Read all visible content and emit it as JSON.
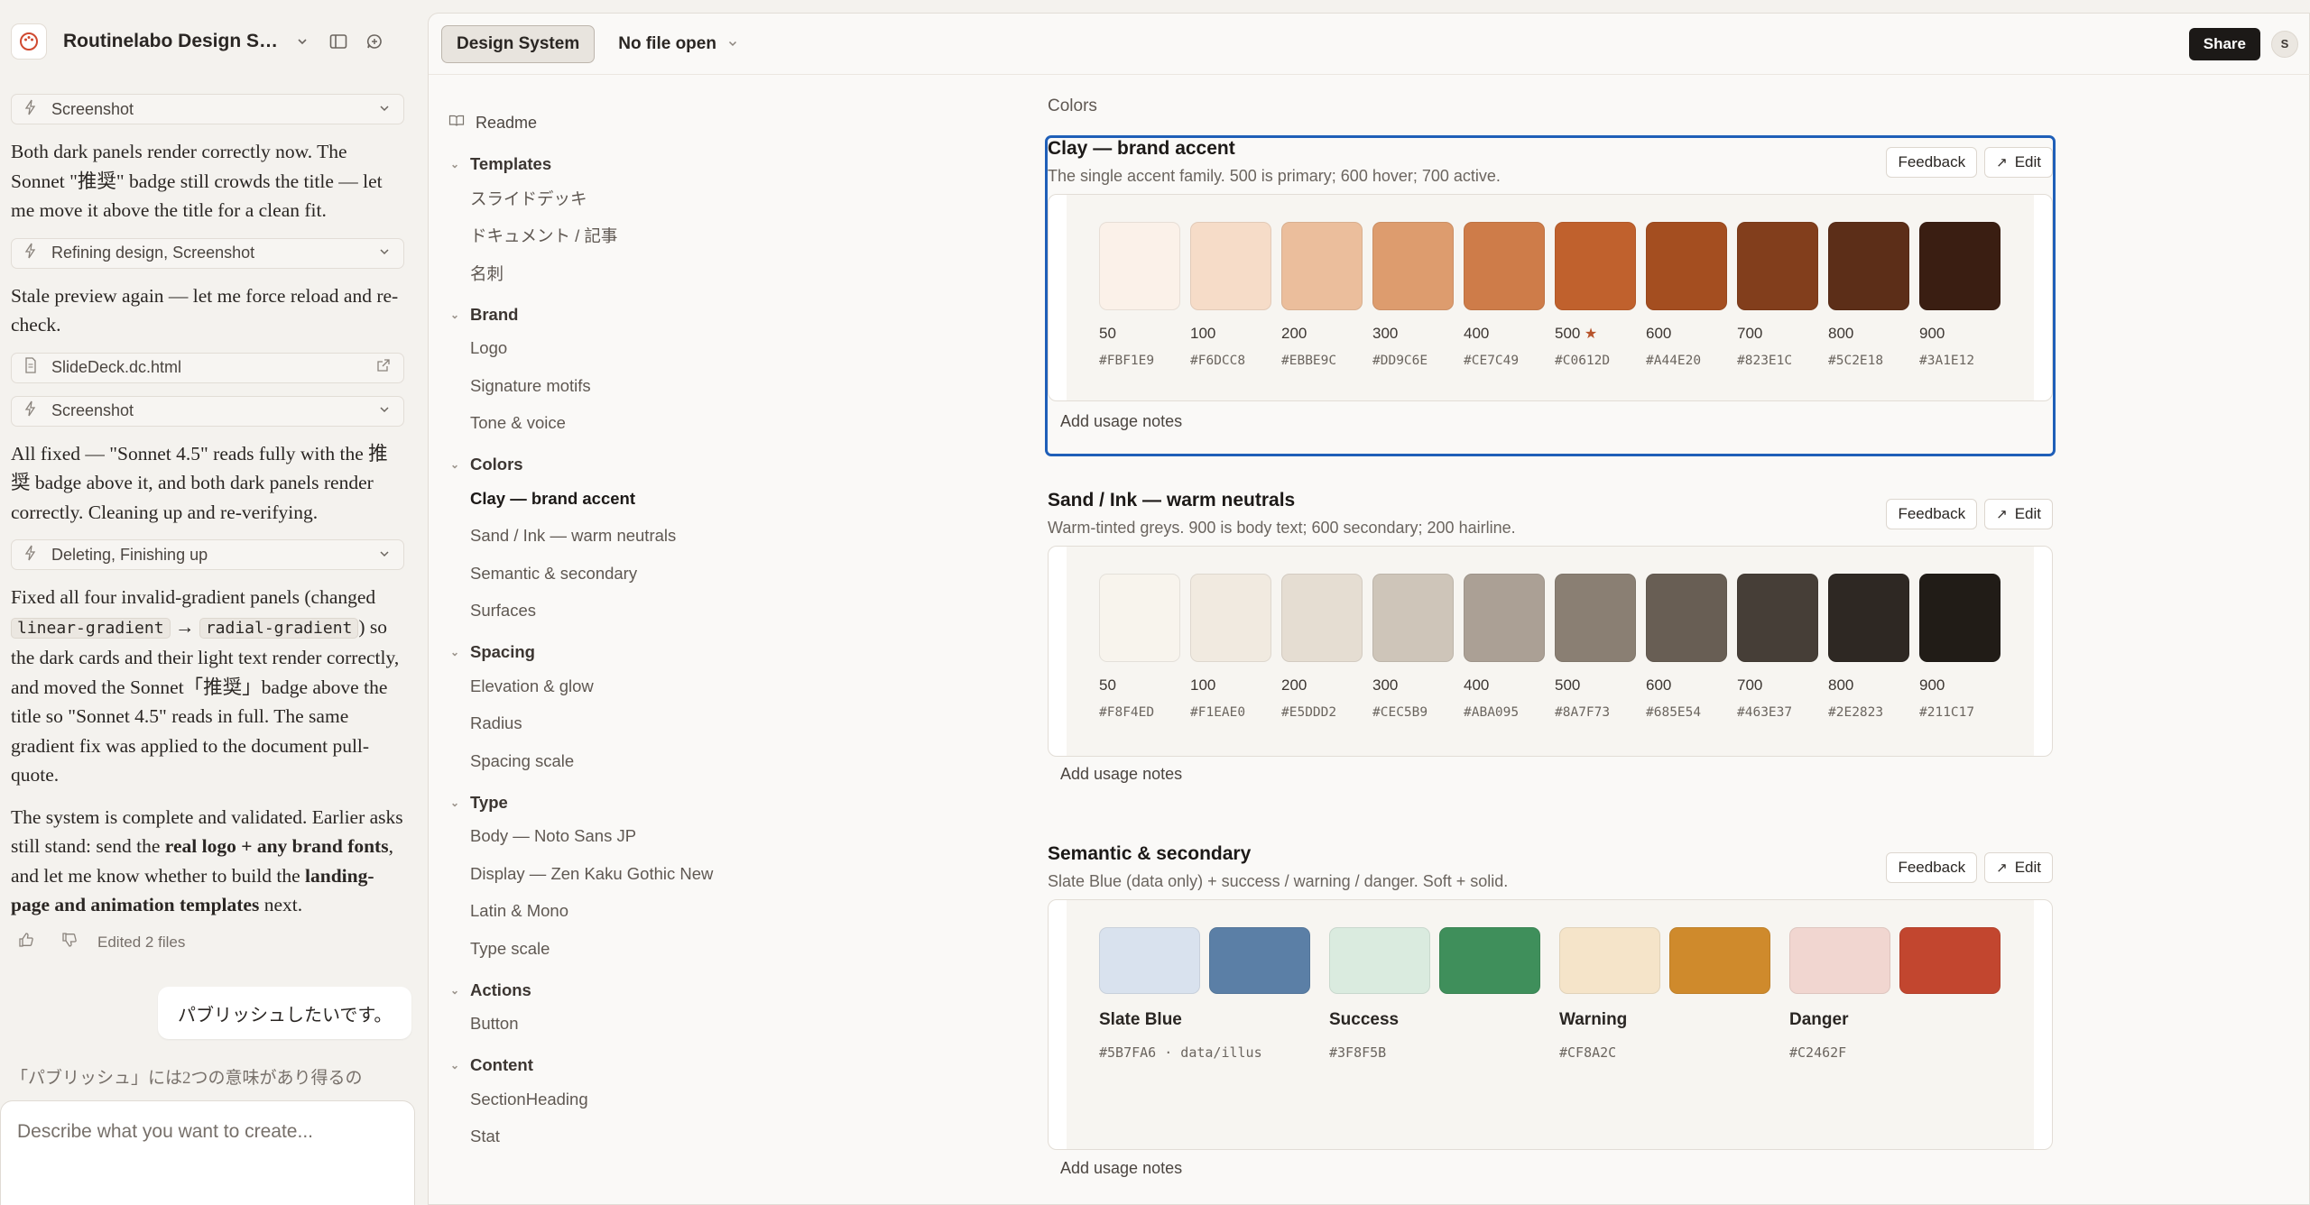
{
  "sidebar_header": {
    "title": "Routinelabo Design Syst..."
  },
  "chat": {
    "tool_screenshot_1": "Screenshot",
    "msg_1": "Both dark panels render correctly now. The Sonnet \"推奨\" badge still crowds the title — let me move it above the title for a clean fit.",
    "tool_refining": "Refining design, Screenshot",
    "msg_2": "Stale preview again — let me force reload and re-check.",
    "file_slidedeck": "SlideDeck.dc.html",
    "tool_screenshot_2": "Screenshot",
    "msg_3": "All fixed — \"Sonnet 4.5\" reads fully with the 推奨 badge above it, and both dark panels render correctly. Cleaning up and re-verifying.",
    "tool_deleting": "Deleting, Finishing up",
    "msg_4_a": "Fixed all four invalid-gradient panels (changed ",
    "msg_4_code1": "linear-gradient",
    "msg_4_arrow": " → ",
    "msg_4_code2": "radial-gradient",
    "msg_4_b": ") so the dark cards and their light text render correctly, and moved the Sonnet「推奨」badge above the title so \"Sonnet 4.5\" reads in full. The same gradient fix was applied to the document pull-quote.",
    "msg_5_a": "The system is complete and validated. Earlier asks still stand: send the ",
    "msg_5_bold1": "real logo + any brand fonts",
    "msg_5_b": ", and let me know whether to build the ",
    "msg_5_bold2": "landing-page and animation templates",
    "msg_5_c": " next.",
    "edited_files": "Edited 2 files",
    "user_message": "パブリッシュしたいです。",
    "trailing_text": "「パブリッシュ」には2つの意味があり得るの",
    "composer_placeholder": "Describe what you want to create..."
  },
  "topbar": {
    "design_system_tab": "Design System",
    "file_selector": "No file open",
    "share_label": "Share",
    "avatar_initial": "S"
  },
  "nav": {
    "readme": "Readme",
    "groups": [
      {
        "title": "Templates",
        "items": [
          "スライドデッキ",
          "ドキュメント / 記事",
          "名刺"
        ]
      },
      {
        "title": "Brand",
        "items": [
          "Logo",
          "Signature motifs",
          "Tone & voice"
        ]
      },
      {
        "title": "Colors",
        "items": [
          "Clay — brand accent",
          "Sand / Ink — warm neutrals",
          "Semantic & secondary",
          "Surfaces"
        ]
      },
      {
        "title": "Spacing",
        "items": [
          "Elevation & glow",
          "Radius",
          "Spacing scale"
        ]
      },
      {
        "title": "Type",
        "items": [
          "Body — Noto Sans JP",
          "Display — Zen Kaku Gothic New",
          "Latin & Mono",
          "Type scale"
        ]
      },
      {
        "title": "Actions",
        "items": [
          "Button"
        ]
      },
      {
        "title": "Content",
        "items": [
          "SectionHeading",
          "Stat"
        ]
      }
    ]
  },
  "content": {
    "section_label": "Colors",
    "feedback_label": "Feedback",
    "edit_label": "Edit",
    "usage_label": "Add usage notes",
    "clay": {
      "title": "Clay — brand accent",
      "subtitle": "The single accent family. 500 is primary; 600 hover; 700 active.",
      "swatches": [
        {
          "step": "50",
          "hex": "#FBF1E9"
        },
        {
          "step": "100",
          "hex": "#F6DCC8"
        },
        {
          "step": "200",
          "hex": "#EBBE9C"
        },
        {
          "step": "300",
          "hex": "#DD9C6E"
        },
        {
          "step": "400",
          "hex": "#CE7C49"
        },
        {
          "step": "500",
          "hex": "#C0612D",
          "star": "★"
        },
        {
          "step": "600",
          "hex": "#A44E20"
        },
        {
          "step": "700",
          "hex": "#823E1C"
        },
        {
          "step": "800",
          "hex": "#5C2E18"
        },
        {
          "step": "900",
          "hex": "#3A1E12"
        }
      ]
    },
    "sand": {
      "title": "Sand / Ink — warm neutrals",
      "subtitle": "Warm-tinted greys. 900 is body text; 600 secondary; 200 hairline.",
      "swatches": [
        {
          "step": "50",
          "hex": "#F8F4ED"
        },
        {
          "step": "100",
          "hex": "#F1EAE0"
        },
        {
          "step": "200",
          "hex": "#E5DDD2"
        },
        {
          "step": "300",
          "hex": "#CEC5B9"
        },
        {
          "step": "400",
          "hex": "#ABA095"
        },
        {
          "step": "500",
          "hex": "#8A7F73"
        },
        {
          "step": "600",
          "hex": "#685E54"
        },
        {
          "step": "700",
          "hex": "#463E37"
        },
        {
          "step": "800",
          "hex": "#2E2823"
        },
        {
          "step": "900",
          "hex": "#211C17"
        }
      ]
    },
    "semantic": {
      "title": "Semantic & secondary",
      "subtitle": "Slate Blue (data only) + success / warning / danger. Soft + solid.",
      "groups": [
        {
          "name": "Slate Blue",
          "hex_label": "#5B7FA6 · data/illus",
          "soft": "#D9E2EE",
          "solid": "#5B7FA6"
        },
        {
          "name": "Success",
          "hex_label": "#3F8F5B",
          "soft": "#DAEBDF",
          "solid": "#3F8F5B"
        },
        {
          "name": "Warning",
          "hex_label": "#CF8A2C",
          "soft": "#F5E4C9",
          "solid": "#CF8A2C"
        },
        {
          "name": "Danger",
          "hex_label": "#C2462F",
          "soft": "#F1D6D0",
          "solid": "#C2462F"
        }
      ]
    }
  }
}
